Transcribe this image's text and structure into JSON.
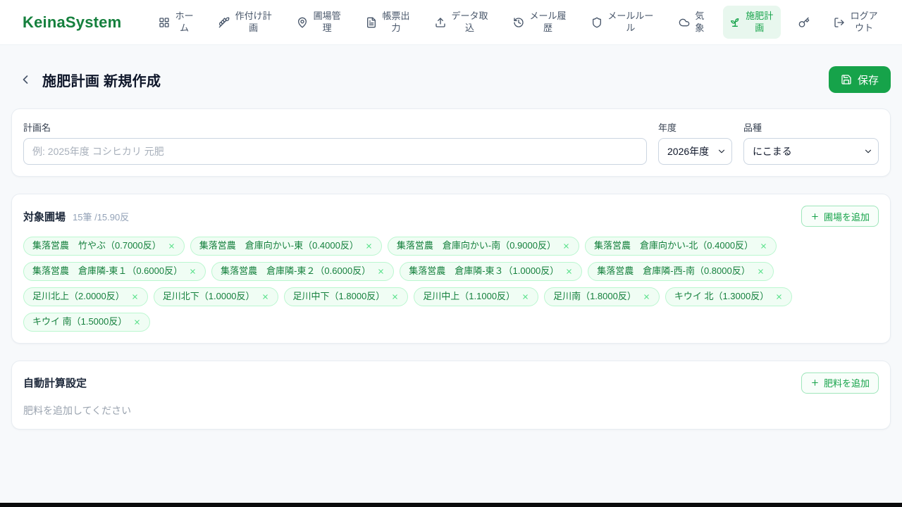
{
  "brand": {
    "name": "KeinaSystem"
  },
  "nav": {
    "items": [
      {
        "id": "home",
        "label": "ホーム",
        "icon": "grid-icon",
        "active": false
      },
      {
        "id": "planting-plan",
        "label": "作付け計画",
        "icon": "wheat-icon",
        "active": false
      },
      {
        "id": "field-management",
        "label": "圃場管理",
        "icon": "map-pin-icon",
        "active": false
      },
      {
        "id": "report-output",
        "label": "帳票出力",
        "icon": "file-icon",
        "active": false
      },
      {
        "id": "data-import",
        "label": "データ取込",
        "icon": "upload-icon",
        "active": false
      },
      {
        "id": "mail-history",
        "label": "メール履歴",
        "icon": "history-icon",
        "active": false
      },
      {
        "id": "mail-rules",
        "label": "メールルール",
        "icon": "shield-icon",
        "active": false
      },
      {
        "id": "weather",
        "label": "気象",
        "icon": "cloud-icon",
        "active": false
      },
      {
        "id": "fertilizer-plan",
        "label": "施肥計画",
        "icon": "sprout-icon",
        "active": true
      },
      {
        "id": "key",
        "label": "",
        "icon": "key-icon",
        "active": false
      },
      {
        "id": "logout",
        "label": "ログアウト",
        "icon": "logout-icon",
        "active": false
      }
    ]
  },
  "header": {
    "title": "施肥計画 新規作成",
    "save_label": "保存"
  },
  "form": {
    "plan_name": {
      "label": "計画名",
      "placeholder": "例: 2025年度 コシヒカリ 元肥",
      "value": ""
    },
    "year": {
      "label": "年度",
      "selected": "2026年度"
    },
    "variety": {
      "label": "品種",
      "selected": "にこまる"
    }
  },
  "fields": {
    "title": "対象圃場",
    "summary": "15筆 /15.90反",
    "add_label": "圃場を追加",
    "tags": [
      {
        "label": "集落営農　竹やぶ（0.7000反）"
      },
      {
        "label": "集落営農　倉庫向かい-東（0.4000反）"
      },
      {
        "label": "集落営農　倉庫向かい-南（0.9000反）"
      },
      {
        "label": "集落営農　倉庫向かい-北（0.4000反）"
      },
      {
        "label": "集落営農　倉庫隣-東１（0.6000反）"
      },
      {
        "label": "集落営農　倉庫隣-東２（0.6000反）"
      },
      {
        "label": "集落営農　倉庫隣-東３（1.0000反）"
      },
      {
        "label": "集落営農　倉庫隣-西-南（0.8000反）"
      },
      {
        "label": "足川北上（2.0000反）"
      },
      {
        "label": "足川北下（1.0000反）"
      },
      {
        "label": "足川中下（1.8000反）"
      },
      {
        "label": "足川中上（1.1000反）"
      },
      {
        "label": "足川南（1.8000反）"
      },
      {
        "label": "キウイ 北（1.3000反）"
      },
      {
        "label": "キウイ 南（1.5000反）"
      }
    ]
  },
  "auto_calc": {
    "title": "自動計算設定",
    "add_label": "肥料を追加",
    "empty_message": "肥料を追加してください"
  }
}
